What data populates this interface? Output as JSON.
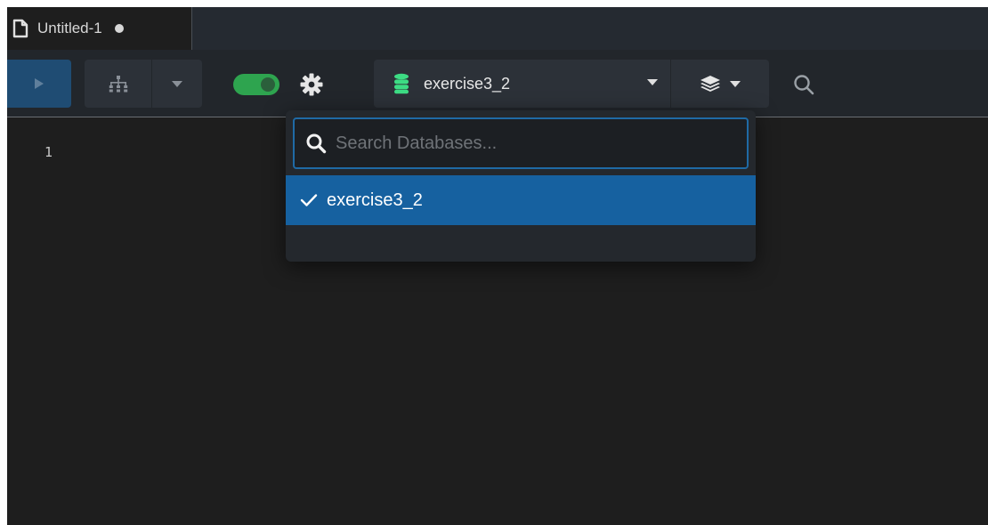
{
  "tab": {
    "title": "Untitled-1",
    "modified": true
  },
  "toolbar": {
    "run_icon": "play-icon",
    "tree_icon": "sitemap-icon",
    "toggle_on": true,
    "database": {
      "selected": "exercise3_2",
      "icon": "database-icon"
    },
    "layers_icon": "layers-icon",
    "search_icon": "search-icon"
  },
  "editor": {
    "line_numbers": [
      "1"
    ]
  },
  "db_dropdown": {
    "search_placeholder": "Search Databases...",
    "search_value": "",
    "options": [
      {
        "label": "exercise3_2",
        "selected": true
      }
    ]
  },
  "colors": {
    "accent": "#1661a0",
    "toggle": "#2ea44f",
    "db_icon": "#3ddc84",
    "background": "#1e1e1e",
    "toolbar": "#22262b"
  }
}
